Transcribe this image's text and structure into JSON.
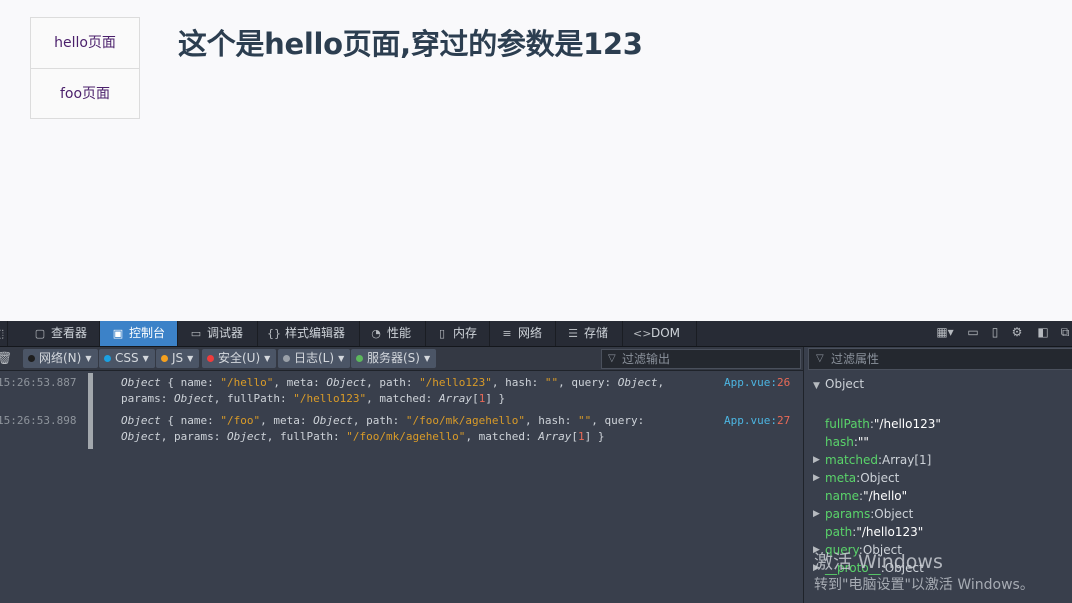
{
  "nav": {
    "links": [
      {
        "label": "hello页面"
      },
      {
        "label": "foo页面"
      }
    ]
  },
  "page": {
    "title": "这个是hello页面,穿过的参数是123"
  },
  "devtools": {
    "tabs": [
      {
        "label": "查看器",
        "icon": "inspector-icon"
      },
      {
        "label": "控制台",
        "icon": "console-icon",
        "active": true
      },
      {
        "label": "调试器",
        "icon": "debugger-icon"
      },
      {
        "label": "样式编辑器",
        "icon": "style-editor-icon"
      },
      {
        "label": "性能",
        "icon": "performance-icon"
      },
      {
        "label": "内存",
        "icon": "memory-icon"
      },
      {
        "label": "网络",
        "icon": "network-icon"
      },
      {
        "label": "存储",
        "icon": "storage-icon"
      },
      {
        "label": "DOM",
        "icon": "dom-icon"
      }
    ],
    "filters": [
      {
        "label": "网络(N)",
        "color": "#2b2b2b"
      },
      {
        "label": "CSS",
        "color": "#1ba0e1"
      },
      {
        "label": "JS",
        "color": "#f5a01e"
      },
      {
        "label": "安全(U)",
        "color": "#f03c3c"
      },
      {
        "label": "日志(L)",
        "color": "#9aa0a8"
      },
      {
        "label": "服务器(S)",
        "color": "#5cb85c"
      }
    ],
    "filter_output_placeholder": "过滤输出",
    "filter_props_placeholder": "过滤属性",
    "logs": [
      {
        "time": "15:26:53.887",
        "line1": [
          {
            "t": "Object",
            "c": "obj"
          },
          {
            "t": " { name: ",
            "c": ""
          },
          {
            "t": "\"/hello\"",
            "c": "str"
          },
          {
            "t": ", meta: ",
            "c": ""
          },
          {
            "t": "Object",
            "c": "obj"
          },
          {
            "t": ", path: ",
            "c": ""
          },
          {
            "t": "\"/hello123\"",
            "c": "str"
          },
          {
            "t": ", hash: ",
            "c": ""
          },
          {
            "t": "\"\"",
            "c": "str"
          },
          {
            "t": ", query: ",
            "c": ""
          },
          {
            "t": "Object",
            "c": "obj"
          },
          {
            "t": ",",
            "c": ""
          }
        ],
        "line2": [
          {
            "t": "params: ",
            "c": ""
          },
          {
            "t": "Object",
            "c": "obj"
          },
          {
            "t": ", fullPath: ",
            "c": ""
          },
          {
            "t": "\"/hello123\"",
            "c": "str"
          },
          {
            "t": ", matched: ",
            "c": ""
          },
          {
            "t": "Array",
            "c": "obj"
          },
          {
            "t": "[",
            "c": ""
          },
          {
            "t": "1",
            "c": "num"
          },
          {
            "t": "] }",
            "c": ""
          }
        ],
        "source": "App.vue",
        "line": "26"
      },
      {
        "time": "15:26:53.898",
        "line1": [
          {
            "t": "Object",
            "c": "obj"
          },
          {
            "t": " { name: ",
            "c": ""
          },
          {
            "t": "\"/foo\"",
            "c": "str"
          },
          {
            "t": ", meta: ",
            "c": ""
          },
          {
            "t": "Object",
            "c": "obj"
          },
          {
            "t": ", path: ",
            "c": ""
          },
          {
            "t": "\"/foo/mk/agehello\"",
            "c": "str"
          },
          {
            "t": ", hash: ",
            "c": ""
          },
          {
            "t": "\"\"",
            "c": "str"
          },
          {
            "t": ", query:",
            "c": ""
          }
        ],
        "line2": [
          {
            "t": "Object",
            "c": "obj"
          },
          {
            "t": ", params: ",
            "c": ""
          },
          {
            "t": "Object",
            "c": "obj"
          },
          {
            "t": ", fullPath: ",
            "c": ""
          },
          {
            "t": "\"/foo/mk/agehello\"",
            "c": "str"
          },
          {
            "t": ", matched: ",
            "c": ""
          },
          {
            "t": "Array",
            "c": "obj"
          },
          {
            "t": "[",
            "c": ""
          },
          {
            "t": "1",
            "c": "num"
          },
          {
            "t": "] }",
            "c": ""
          }
        ],
        "source": "App.vue",
        "line": "27"
      }
    ],
    "inspector": {
      "root": "Object",
      "props": [
        {
          "key": "fullPath",
          "value": "\"/hello123\"",
          "expandable": false
        },
        {
          "key": "hash",
          "value": "\"\"",
          "expandable": false
        },
        {
          "key": "matched",
          "value": "Array[1]",
          "expandable": true
        },
        {
          "key": "meta",
          "value": "Object",
          "expandable": true
        },
        {
          "key": "name",
          "value": "\"/hello\"",
          "expandable": false
        },
        {
          "key": "params",
          "value": "Object",
          "expandable": true
        },
        {
          "key": "path",
          "value": "\"/hello123\"",
          "expandable": false
        },
        {
          "key": "query",
          "value": "Object",
          "expandable": true
        },
        {
          "key": "__proto__",
          "value": "Object",
          "expandable": true
        }
      ]
    }
  },
  "watermark": {
    "title": "激活 Windows",
    "subtitle": "转到\"电脑设置\"以激活 Windows。"
  }
}
